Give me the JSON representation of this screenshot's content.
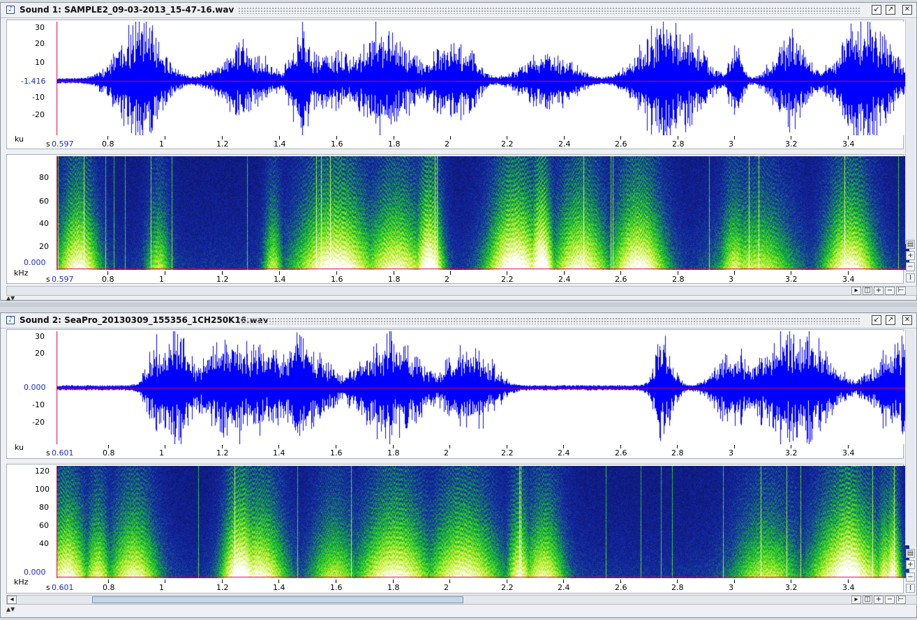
{
  "windows": [
    {
      "title": "Sound 1: SAMPLE2_09-03-2013_15-47-16.wav",
      "waveform": {
        "y_ticks": [
          "30",
          "20",
          "10",
          "-10",
          "-20"
        ],
        "cursor_value": "-1.416",
        "unit": "ku"
      },
      "spectrogram": {
        "y_ticks": [
          "80",
          "60",
          "40",
          "20"
        ],
        "cursor_value": "0.000",
        "unit": "kHz"
      },
      "time_axis": {
        "unit": "s",
        "start": "0.597",
        "ticks": [
          "0.8",
          "1",
          "1.2",
          "1.4",
          "1.6",
          "1.8",
          "2",
          "2.2",
          "2.4",
          "2.6",
          "2.8",
          "3",
          "3.2",
          "3.4"
        ]
      }
    },
    {
      "title": "Sound 2: SeaPro_20130309_155356_1CH250K16.wav",
      "waveform": {
        "y_ticks": [
          "30",
          "20",
          "-10",
          "-20"
        ],
        "cursor_value": "0.000",
        "unit": "ku"
      },
      "spectrogram": {
        "y_ticks": [
          "120",
          "100",
          "80",
          "60",
          "40"
        ],
        "cursor_value": "0.000",
        "unit": "kHz"
      },
      "time_axis": {
        "unit": "s",
        "start": "0.601",
        "ticks": [
          "0.8",
          "1",
          "1.2",
          "1.4",
          "1.6",
          "1.8",
          "2",
          "2.2",
          "2.4",
          "2.6",
          "2.8",
          "3",
          "3.2",
          "3.4"
        ]
      }
    }
  ],
  "icons": [
    "sound-file-icon",
    "minimize-icon",
    "maximize-icon",
    "close-icon",
    "scroll-left-icon",
    "scroll-right-icon",
    "zoom-fit-icon",
    "zoom-in-icon",
    "zoom-out-icon",
    "zoom-max-icon"
  ],
  "colors": {
    "waveform": "#0000ff",
    "cursor": "#e0004a",
    "spec_low": "#0a0a5a",
    "spec_mid": "#19c81e",
    "spec_high": "#ffffff",
    "label_blue": "#1a2bd0"
  }
}
